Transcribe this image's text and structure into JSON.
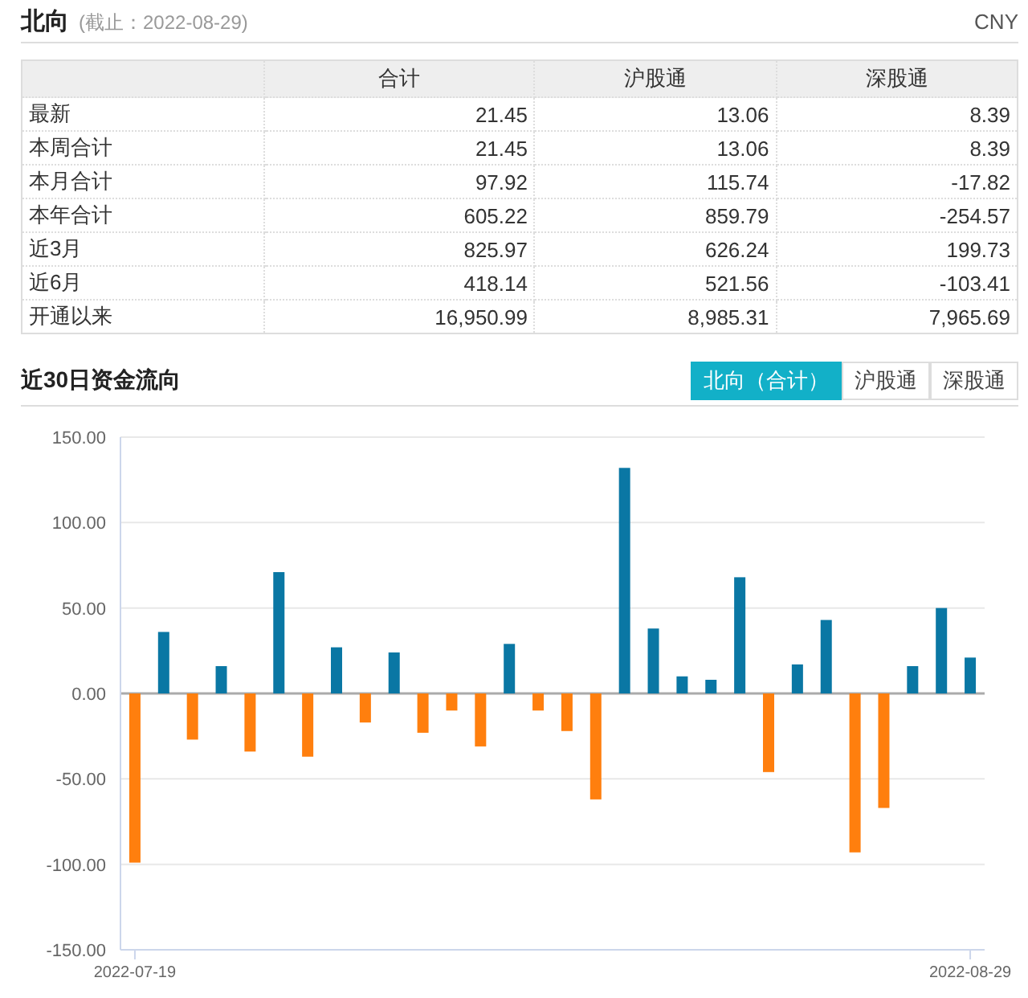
{
  "header": {
    "title": "北向",
    "date_note": "(截止：2022-08-29)",
    "currency": "CNY"
  },
  "table": {
    "columns": [
      "",
      "合计",
      "沪股通",
      "深股通"
    ],
    "rows": [
      [
        "最新",
        "21.45",
        "13.06",
        "8.39"
      ],
      [
        "本周合计",
        "21.45",
        "13.06",
        "8.39"
      ],
      [
        "本月合计",
        "97.92",
        "115.74",
        "-17.82"
      ],
      [
        "本年合计",
        "605.22",
        "859.79",
        "-254.57"
      ],
      [
        "近3月",
        "825.97",
        "626.24",
        "199.73"
      ],
      [
        "近6月",
        "418.14",
        "521.56",
        "-103.41"
      ],
      [
        "开通以来",
        "16,950.99",
        "8,985.31",
        "7,965.69"
      ]
    ]
  },
  "flow_section": {
    "title": "近30日资金流向",
    "tabs": [
      {
        "label": "北向（合计）",
        "selected": true
      },
      {
        "label": "沪股通",
        "selected": false
      },
      {
        "label": "深股通",
        "selected": false
      }
    ],
    "chart_data": {
      "type": "bar",
      "ylim": [
        -150,
        150
      ],
      "yticks": [
        {
          "value": 150,
          "label": "150.00"
        },
        {
          "value": 100,
          "label": "100.00"
        },
        {
          "value": 50,
          "label": "50.00"
        },
        {
          "value": 0,
          "label": "0.00"
        },
        {
          "value": -50,
          "label": "-50.00"
        },
        {
          "value": -100,
          "label": "-100.00"
        },
        {
          "value": -150,
          "label": "-150.00"
        }
      ],
      "grid": true,
      "stacked": true,
      "categories": [
        "2022-07-19",
        null,
        null,
        null,
        null,
        null,
        null,
        null,
        null,
        null,
        null,
        null,
        null,
        null,
        null,
        null,
        null,
        null,
        null,
        null,
        null,
        null,
        null,
        null,
        null,
        null,
        null,
        null,
        null,
        "2022-08-29"
      ],
      "series": [
        {
          "color": "#0a77a4",
          "values": [
            null,
            36,
            null,
            16,
            null,
            71,
            null,
            27,
            null,
            24,
            null,
            null,
            null,
            29,
            null,
            null,
            null,
            132,
            38,
            10,
            8,
            68,
            null,
            17,
            43,
            null,
            null,
            16,
            50,
            21
          ]
        },
        {
          "color": "#ff7f0e",
          "values": [
            -99,
            null,
            -27,
            null,
            -34,
            null,
            -37,
            null,
            -17,
            null,
            -23,
            -10,
            -31,
            null,
            -10,
            -22,
            -62,
            null,
            null,
            null,
            null,
            null,
            -46,
            null,
            null,
            -93,
            -67,
            null,
            null,
            null
          ]
        }
      ]
    }
  }
}
